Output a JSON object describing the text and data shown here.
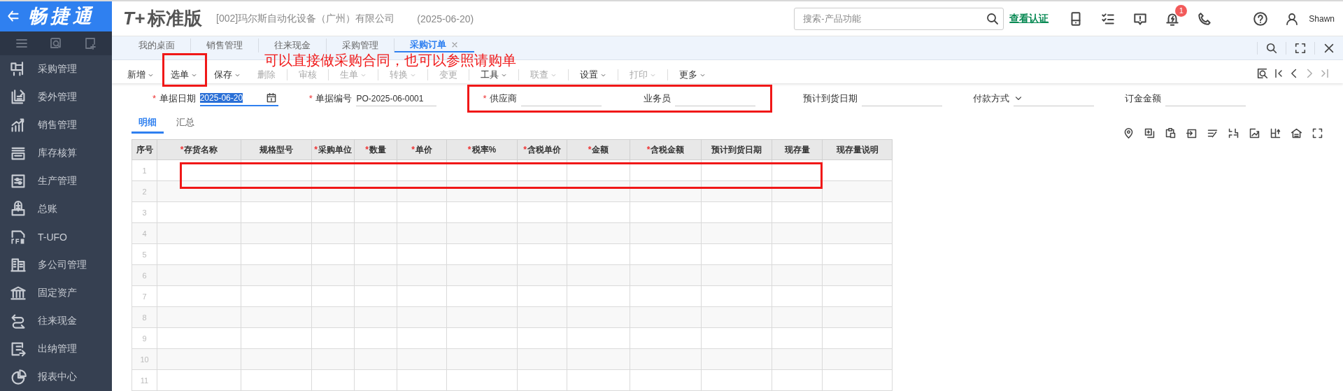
{
  "app": {
    "brand": "畅捷通",
    "product_mark": "T+",
    "product": "标准版",
    "company": "[002]玛尔斯自动化设备（广州）有限公司",
    "date": "(2025-06-20)"
  },
  "header": {
    "search": {
      "placeholder": "搜索-产品功能"
    },
    "link": "查看认证",
    "notifications": "1",
    "user": "Shawn"
  },
  "sidebar": {
    "items": [
      {
        "label": "采购管理"
      },
      {
        "label": "委外管理"
      },
      {
        "label": "销售管理"
      },
      {
        "label": "库存核算"
      },
      {
        "label": "生产管理"
      },
      {
        "label": "总账"
      },
      {
        "label": "T-UFO"
      },
      {
        "label": "多公司管理"
      },
      {
        "label": "固定资产"
      },
      {
        "label": "往来现金"
      },
      {
        "label": "出纳管理"
      },
      {
        "label": "报表中心"
      }
    ]
  },
  "tabs": [
    {
      "label": "我的桌面",
      "selected": false,
      "closable": false
    },
    {
      "label": "销售管理",
      "selected": false,
      "closable": false
    },
    {
      "label": "往来现金",
      "selected": false,
      "closable": false
    },
    {
      "label": "采购管理",
      "selected": false,
      "closable": false
    },
    {
      "label": "采购订单",
      "selected": true,
      "closable": true
    }
  ],
  "toolbar": [
    {
      "label": "新增",
      "dropdown": true,
      "disabled": false,
      "highlighted": false
    },
    {
      "label": "选单",
      "dropdown": true,
      "disabled": false,
      "highlighted": true
    },
    {
      "label": "保存",
      "dropdown": true,
      "disabled": false,
      "highlighted": false
    },
    {
      "label": "删除",
      "dropdown": false,
      "disabled": true,
      "highlighted": false
    },
    {
      "label": "审核",
      "dropdown": false,
      "disabled": true,
      "highlighted": false
    },
    {
      "label": "生单",
      "dropdown": true,
      "disabled": true,
      "highlighted": false
    },
    {
      "label": "转换",
      "dropdown": true,
      "disabled": true,
      "highlighted": false
    },
    {
      "label": "变更",
      "dropdown": false,
      "disabled": true,
      "highlighted": false
    },
    {
      "label": "工具",
      "dropdown": true,
      "disabled": false,
      "highlighted": false
    },
    {
      "label": "联查",
      "dropdown": true,
      "disabled": true,
      "highlighted": false
    },
    {
      "label": "设置",
      "dropdown": true,
      "disabled": false,
      "highlighted": false
    },
    {
      "label": "打印",
      "dropdown": true,
      "disabled": true,
      "highlighted": false
    },
    {
      "label": "更多",
      "dropdown": true,
      "disabled": false,
      "highlighted": false
    }
  ],
  "form": {
    "fields": [
      {
        "label": "单据日期",
        "kind": "date",
        "mark": "*",
        "value": "2025-06-20",
        "text_selected": true,
        "highlighted": false
      },
      {
        "label": "单据编号",
        "kind": "text",
        "mark": "*",
        "value": "PO-2025-06-0001",
        "highlighted": false
      },
      {
        "label": "供应商",
        "kind": "text",
        "mark": "*",
        "highlighted": true
      },
      {
        "label": "业务员",
        "kind": "text",
        "highlighted": true
      },
      {
        "label": "预计到货日期",
        "kind": "text",
        "highlighted": false
      },
      {
        "label": "付款方式",
        "kind": "select",
        "highlighted": false
      },
      {
        "label": "订金金额",
        "kind": "text",
        "highlighted": false
      }
    ]
  },
  "detail_tabs": [
    {
      "label": "明细",
      "selected": true
    },
    {
      "label": "汇总",
      "selected": false
    }
  ],
  "table": {
    "columns": [
      {
        "label": "序号"
      },
      {
        "label": "存货名称",
        "mark": "*"
      },
      {
        "label": "规格型号"
      },
      {
        "label": "采购单位",
        "mark": "*"
      },
      {
        "label": "数量",
        "mark": "*"
      },
      {
        "label": "单价",
        "mark": "*"
      },
      {
        "label": "税率%",
        "mark": "*"
      },
      {
        "label": "含税单价",
        "mark": "*"
      },
      {
        "label": "金额",
        "mark": "*"
      },
      {
        "label": "含税金额",
        "mark": "*"
      },
      {
        "label": "预计到货日期"
      },
      {
        "label": "现存量"
      },
      {
        "label": "现存量说明"
      }
    ],
    "rows": [
      {
        "number": "1",
        "highlighted": true
      },
      {
        "number": "2",
        "highlighted": false
      },
      {
        "number": "3",
        "highlighted": false
      },
      {
        "number": "4",
        "highlighted": false
      },
      {
        "number": "5",
        "highlighted": false
      },
      {
        "number": "6",
        "highlighted": false
      },
      {
        "number": "7",
        "highlighted": false
      },
      {
        "number": "8",
        "highlighted": false
      },
      {
        "number": "9",
        "highlighted": false
      },
      {
        "number": "10",
        "highlighted": false
      },
      {
        "number": "11",
        "highlighted": false
      }
    ]
  },
  "annotation": {
    "note": "可以直接做采购合同，也可以参照请购单"
  }
}
